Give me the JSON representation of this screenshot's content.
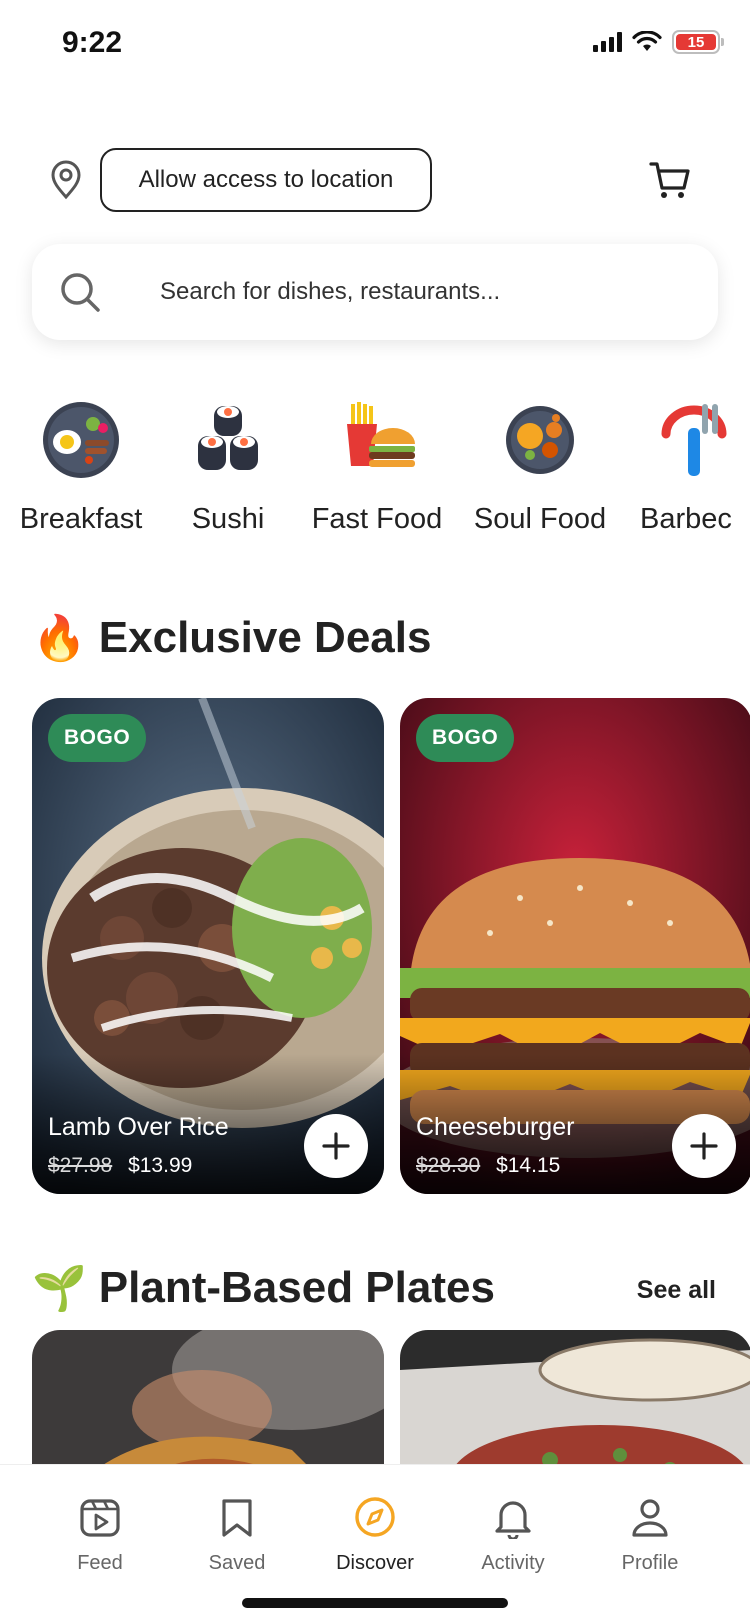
{
  "status_bar": {
    "time": "9:22",
    "battery": "15"
  },
  "header": {
    "location_button": "Allow access to location"
  },
  "search": {
    "placeholder": "Search for dishes, restaurants..."
  },
  "categories": [
    "Breakfast",
    "Sushi",
    "Fast Food",
    "Soul Food",
    "Barbec"
  ],
  "exclusive_deals": {
    "emoji": "🔥",
    "title": "Exclusive Deals",
    "items": [
      {
        "badge": "BOGO",
        "name": "Lamb Over Rice",
        "old_price": "$27.98",
        "new_price": "$13.99"
      },
      {
        "badge": "BOGO",
        "name": "Cheeseburger",
        "old_price": "$28.30",
        "new_price": "$14.15"
      }
    ]
  },
  "plant_based": {
    "emoji": "🌱",
    "title": "Plant-Based Plates",
    "see_all": "See all"
  },
  "tab_bar": {
    "items": [
      {
        "label": "Feed",
        "icon": "feed-icon",
        "active": false
      },
      {
        "label": "Saved",
        "icon": "bookmark-icon",
        "active": false
      },
      {
        "label": "Discover",
        "icon": "compass-icon",
        "active": true
      },
      {
        "label": "Activity",
        "icon": "bell-icon",
        "active": false
      },
      {
        "label": "Profile",
        "icon": "person-icon",
        "active": false
      }
    ]
  },
  "colors": {
    "badge_green": "#2e8b57",
    "accent_orange": "#f5a623",
    "battery_red": "#e53935"
  }
}
